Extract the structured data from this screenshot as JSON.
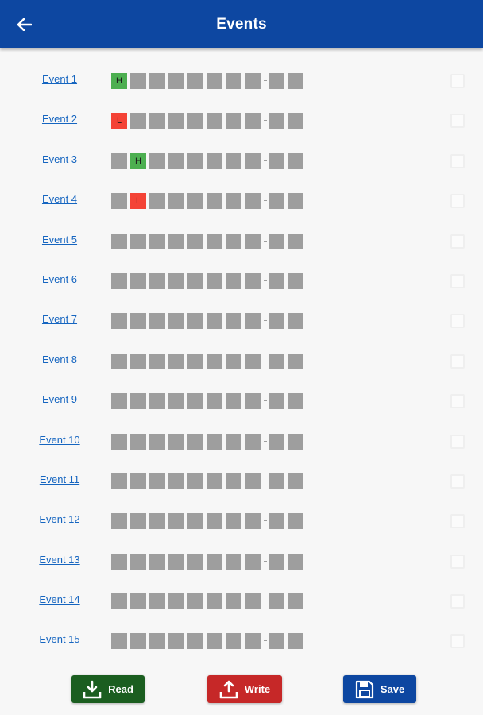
{
  "header": {
    "title": "Events",
    "back_icon": "arrow-left-icon"
  },
  "events": [
    {
      "label": "Event 1",
      "underlined": true,
      "cells": [
        "H",
        "",
        "",
        "",
        "",
        "",
        "",
        "",
        "",
        ""
      ]
    },
    {
      "label": "Event 2",
      "underlined": true,
      "cells": [
        "L",
        "",
        "",
        "",
        "",
        "",
        "",
        "",
        "",
        ""
      ]
    },
    {
      "label": "Event 3",
      "underlined": true,
      "cells": [
        "",
        "H",
        "",
        "",
        "",
        "",
        "",
        "",
        "",
        ""
      ]
    },
    {
      "label": "Event 4",
      "underlined": true,
      "cells": [
        "",
        "L",
        "",
        "",
        "",
        "",
        "",
        "",
        "",
        ""
      ]
    },
    {
      "label": "Event 5",
      "underlined": true,
      "cells": [
        "",
        "",
        "",
        "",
        "",
        "",
        "",
        "",
        "",
        ""
      ]
    },
    {
      "label": "Event 6",
      "underlined": true,
      "cells": [
        "",
        "",
        "",
        "",
        "",
        "",
        "",
        "",
        "",
        ""
      ]
    },
    {
      "label": "Event 7",
      "underlined": true,
      "cells": [
        "",
        "",
        "",
        "",
        "",
        "",
        "",
        "",
        "",
        ""
      ]
    },
    {
      "label": "Event 8",
      "underlined": false,
      "cells": [
        "",
        "",
        "",
        "",
        "",
        "",
        "",
        "",
        "",
        ""
      ]
    },
    {
      "label": "Event 9",
      "underlined": true,
      "cells": [
        "",
        "",
        "",
        "",
        "",
        "",
        "",
        "",
        "",
        ""
      ]
    },
    {
      "label": "Event 10",
      "underlined": true,
      "cells": [
        "",
        "",
        "",
        "",
        "",
        "",
        "",
        "",
        "",
        ""
      ]
    },
    {
      "label": "Event 11",
      "underlined": true,
      "cells": [
        "",
        "",
        "",
        "",
        "",
        "",
        "",
        "",
        "",
        ""
      ]
    },
    {
      "label": "Event 12",
      "underlined": true,
      "cells": [
        "",
        "",
        "",
        "",
        "",
        "",
        "",
        "",
        "",
        ""
      ]
    },
    {
      "label": "Event 13",
      "underlined": true,
      "cells": [
        "",
        "",
        "",
        "",
        "",
        "",
        "",
        "",
        "",
        ""
      ]
    },
    {
      "label": "Event 14",
      "underlined": true,
      "cells": [
        "",
        "",
        "",
        "",
        "",
        "",
        "",
        "",
        "",
        ""
      ]
    },
    {
      "label": "Event 15",
      "underlined": true,
      "cells": [
        "",
        "",
        "",
        "",
        "",
        "",
        "",
        "",
        "",
        ""
      ]
    }
  ],
  "cell_colors": {
    "empty": "#9e9e9e",
    "H": "#4caf50",
    "L": "#f44336"
  },
  "actions": {
    "read": {
      "label": "Read",
      "icon": "download-icon",
      "color": "#1b5e20"
    },
    "write": {
      "label": "Write",
      "icon": "upload-icon",
      "color": "#c62828"
    },
    "save": {
      "label": "Save",
      "icon": "floppy-disk-icon",
      "color": "#0d47a1"
    }
  },
  "theme": {
    "primary": "#0d47a1",
    "link": "#1565c0",
    "background": "#f7f7f7"
  }
}
